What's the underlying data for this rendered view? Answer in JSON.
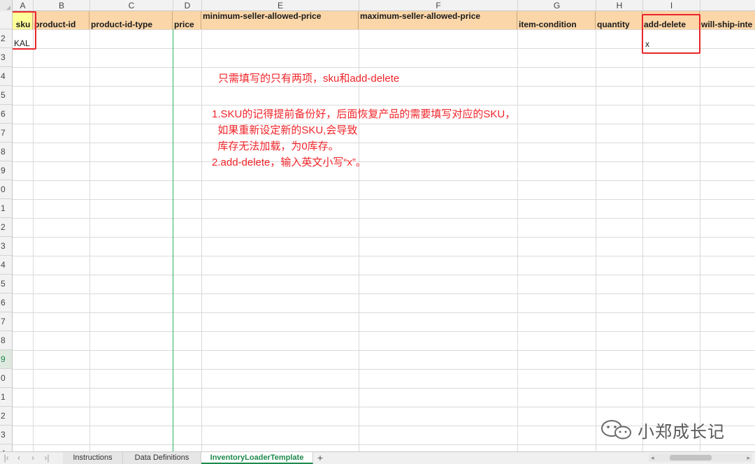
{
  "columns": {
    "letters": [
      "A",
      "B",
      "C",
      "D",
      "E",
      "F",
      "G",
      "H",
      "I"
    ],
    "partial_header": "will-ship-inte"
  },
  "headers": {
    "sku": "sku",
    "product_id": "product-id",
    "product_id_type": "product-id-type",
    "price": "price",
    "min_price": "minimum-seller-allowed-price",
    "max_price": "maximum-seller-allowed-price",
    "item_condition": "item-condition",
    "quantity": "quantity",
    "add_delete": "add-delete"
  },
  "row_numbers": [
    "2",
    "3",
    "4",
    "5",
    "6",
    "7",
    "8",
    "9",
    "0",
    "1",
    "2",
    "3",
    "4",
    "5",
    "6",
    "7",
    "8",
    "9",
    "0",
    "1",
    "2",
    "3",
    "4"
  ],
  "data_row": {
    "sku_value": "KAL",
    "add_delete_value": "x"
  },
  "notes": {
    "line1": "只需填写的只有两项，sku和add-delete",
    "line2": "1.SKU的记得提前备份好，后面恢复产品的需要填写对应的SKU，",
    "line3": "  如果重新设定新的SKU,会导致",
    "line4": "  库存无法加载，为0库存。",
    "line5": "2.add-delete，输入英文小写“x”。"
  },
  "tabs": [
    {
      "label": "Instructions"
    },
    {
      "label": "Data Definitions"
    },
    {
      "label": "InventoryLoaderTemplate"
    }
  ],
  "active_tab": "InventoryLoaderTemplate",
  "watermark": {
    "text": "小郑成长记",
    "icon": "wechat-icon"
  },
  "colors": {
    "header_fill": "#fbd6a8",
    "sku_fill": "#ffff99",
    "highlight_red": "#e8262a",
    "note_red": "#f0252a",
    "accent_green": "#1e8a4c"
  }
}
